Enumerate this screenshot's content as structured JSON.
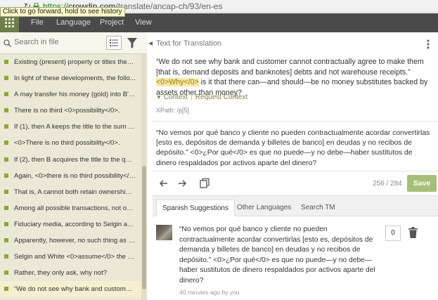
{
  "browser": {
    "tooltip": "Click to go forward, hold to see history",
    "url_scheme": "https://",
    "url_host": "crowdin.com",
    "url_path": "/translate/ancap-ch/93/en-es"
  },
  "menu": {
    "items": [
      "File",
      "Language",
      "Project",
      "View"
    ]
  },
  "left_panel": {
    "search_placeholder": "Search in file",
    "strings": [
      "Existing (present) property or titles there...",
      "In light of these developments, the follo...",
      "A may transfer his money (gold) into B's ...",
      "There is no third <0>possibility</0>.",
      "If (1), then A keeps the title to the sum of...",
      "<0>There is no third possibility</0>.",
      "If (2), then B acquires the title to the qua...",
      "Again, <0>there is no third possibility</0>...",
      "That is, A cannot both retain ownership ...",
      "Among all possible transactions, not one...",
      "Fiduciary media, according to Selgin and...",
      "Apparently, however, no such thing as “m...",
      "Selgin and White <0>assume</0> the exi...",
      "Rather, they only ask, why not?",
      "“We do not see why bank and customer ..."
    ],
    "active_index": 14
  },
  "editor": {
    "title": "Text for Translation",
    "source_part1": "“We do not see why bank and customer cannot contractually agree to make them [that is, demand deposits and banknotes] debts and not warehouse receipts.” ",
    "source_tag": "<0>Why</0>",
    "source_part2": " is it that there can—and should—be no money substitutes backed by assets other than money?",
    "context_label": "Context",
    "request_context_label": "Request Context",
    "xpath": "XPath: /p[5]",
    "translation": "“No vemos por qué banco y cliente no pueden contractualmente acordar convertirlas [esto es, depósitos de demanda y billetes de banco] en deudas y no recibos de depósito.” <0>¿Por qué</0> es que no puede—y no debe—haber sustitutos de dinero respaldados por activos aparte del dinero?",
    "counter": "256 / 284",
    "save_label": "Save"
  },
  "tabs": [
    "Spanish Suggestions",
    "Other Languages",
    "Search TM"
  ],
  "suggestion": {
    "text": "“No vemos por qué banco y cliente no pueden contractualmente acordar convertirlas [esto es, depósitos de demanda y billetes de banco] en deudas y no recibos de depósito.” <0>¿Por qué</0> es que no puede—y no debe—haber sustitutos de dinero respaldados por activos aparte del dinero?",
    "meta": "40 minutes ago by you",
    "votes": "0"
  },
  "colors": {
    "accent_green": "#8aa83a",
    "save_button": "#a6bf78",
    "topbar": "#4a4a4a"
  }
}
